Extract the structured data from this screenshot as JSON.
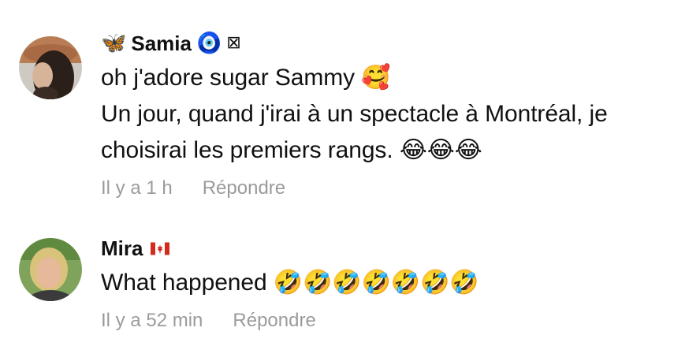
{
  "comments": [
    {
      "author_prefix_emoji": "🦋",
      "author": "Samia",
      "author_suffix_emoji": "🧿",
      "author_extra_glyph": "⊠",
      "lines": [
        "oh j'adore sugar Sammy",
        "Un jour, quand j'irai à un spectacle à Montréal, je",
        "choisirai les premiers rangs."
      ],
      "line1_emoji": "🥰",
      "line3_emoji": "😂😂😂",
      "time": "Il y a 1 h",
      "reply_label": "Répondre"
    },
    {
      "author": "Mira",
      "author_flag": "🇨🇦",
      "lines": [
        "What happened"
      ],
      "line1_emoji": "🤣🤣🤣🤣🤣🤣🤣",
      "time": "Il y a 52 min",
      "reply_label": "Répondre"
    }
  ],
  "colors": {
    "meta_text": "#9b9b9b",
    "body_text": "#111111",
    "butterfly": "#3aa0e8",
    "flag_red": "#d52b1e"
  }
}
